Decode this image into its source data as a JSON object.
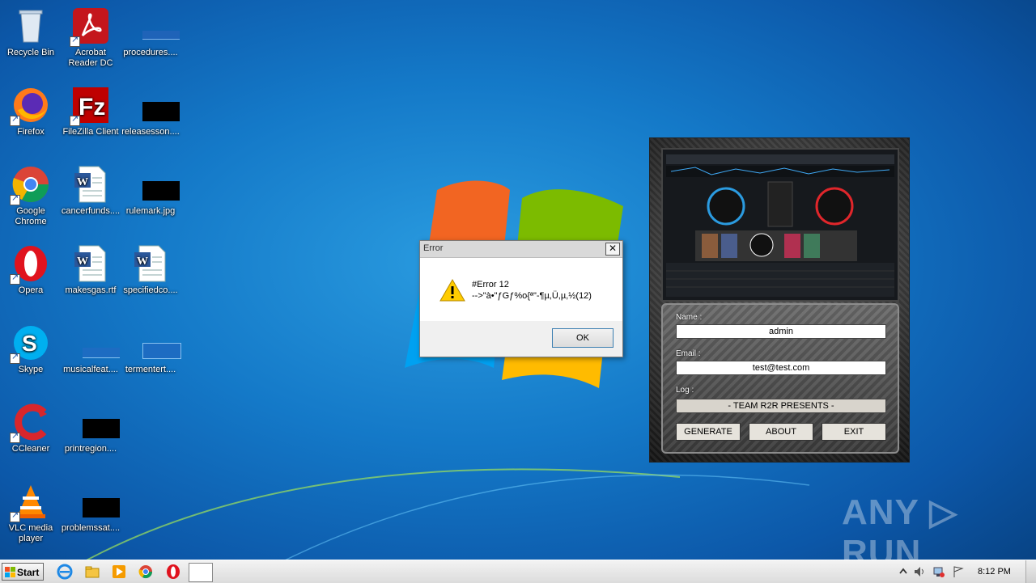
{
  "desktop": {
    "icons": [
      {
        "label": "Recycle Bin",
        "icon": "recycle-bin-icon"
      },
      {
        "label": "Acrobat Reader DC",
        "icon": "acrobat-icon"
      },
      {
        "label": "procedures....",
        "icon": "file-icon"
      },
      {
        "label": "Firefox",
        "icon": "firefox-icon"
      },
      {
        "label": "FileZilla Client",
        "icon": "filezilla-icon"
      },
      {
        "label": "releasesson....",
        "icon": "file-icon"
      },
      {
        "label": "Google Chrome",
        "icon": "chrome-icon"
      },
      {
        "label": "cancerfunds....",
        "icon": "word-doc-icon"
      },
      {
        "label": "rulemark.jpg",
        "icon": "image-file-icon"
      },
      {
        "label": "Opera",
        "icon": "opera-icon"
      },
      {
        "label": "makesgas.rtf",
        "icon": "word-doc-icon"
      },
      {
        "label": "specifiedco....",
        "icon": "word-doc-icon"
      },
      {
        "label": "Skype",
        "icon": "skype-icon"
      },
      {
        "label": "musicalfeat....",
        "icon": "file-icon"
      },
      {
        "label": "termentert....",
        "icon": "file-icon"
      },
      {
        "label": "CCleaner",
        "icon": "ccleaner-icon"
      },
      {
        "label": "printregion....",
        "icon": "file-icon"
      },
      {
        "label": "VLC media player",
        "icon": "vlc-icon"
      },
      {
        "label": "problemssat....",
        "icon": "file-icon"
      }
    ]
  },
  "error_dialog": {
    "title": "Error",
    "close": "✕",
    "line1": "#Error 12",
    "line2": "-->\"à•\"ƒGƒ%o{ª\"-¶µ,Ü,µ,½(12)",
    "ok": "OK"
  },
  "keygen": {
    "name_label": "Name :",
    "name_value": "admin",
    "email_label": "Email :",
    "email_value": "test@test.com",
    "log_label": "Log :",
    "log_value": "- TEAM R2R PRESENTS -",
    "generate": "GENERATE",
    "about": "ABOUT",
    "exit": "EXIT"
  },
  "watermark": "ANY ▷ RUN",
  "taskbar": {
    "start": "Start",
    "clock": "8:12 PM",
    "apps": [
      "ie-icon",
      "explorer-icon",
      "media-player-icon",
      "chrome-icon",
      "opera-icon"
    ]
  }
}
